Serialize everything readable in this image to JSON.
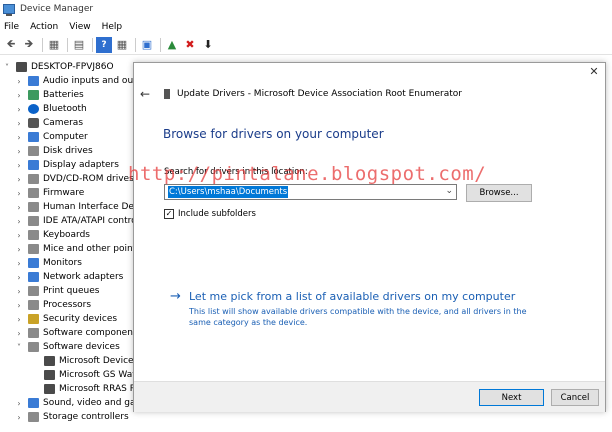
{
  "window": {
    "title": "Device Manager"
  },
  "menu": [
    "File",
    "Action",
    "View",
    "Help"
  ],
  "toolbar": [
    "back-arrow-icon",
    "forward-arrow-icon",
    "properties-icon",
    "scan-icon",
    "help-icon",
    "details-icon",
    "monitor-icon",
    "update-driver-icon",
    "uninstall-x-icon",
    "download-icon"
  ],
  "tree": {
    "root": "DESKTOP-FPVJ86O",
    "items": [
      {
        "label": "Audio inputs and out",
        "icon": "blue",
        "expanded": false
      },
      {
        "label": "Batteries",
        "icon": "green",
        "expanded": false
      },
      {
        "label": "Bluetooth",
        "icon": "bt",
        "expanded": false
      },
      {
        "label": "Cameras",
        "icon": "cam",
        "expanded": false
      },
      {
        "label": "Computer",
        "icon": "blue",
        "expanded": false
      },
      {
        "label": "Disk drives",
        "icon": "grey",
        "expanded": false
      },
      {
        "label": "Display adapters",
        "icon": "blue",
        "expanded": false
      },
      {
        "label": "DVD/CD-ROM drives",
        "icon": "grey",
        "expanded": false
      },
      {
        "label": "Firmware",
        "icon": "grey",
        "expanded": false
      },
      {
        "label": "Human Interface Dev",
        "icon": "grey",
        "expanded": false
      },
      {
        "label": "IDE ATA/ATAPI contro",
        "icon": "grey",
        "expanded": false
      },
      {
        "label": "Keyboards",
        "icon": "grey",
        "expanded": false
      },
      {
        "label": "Mice and other point",
        "icon": "grey",
        "expanded": false
      },
      {
        "label": "Monitors",
        "icon": "blue",
        "expanded": false
      },
      {
        "label": "Network adapters",
        "icon": "blue",
        "expanded": false
      },
      {
        "label": "Print queues",
        "icon": "grey",
        "expanded": false
      },
      {
        "label": "Processors",
        "icon": "grey",
        "expanded": false
      },
      {
        "label": "Security devices",
        "icon": "gold",
        "expanded": false
      },
      {
        "label": "Software component",
        "icon": "grey",
        "expanded": false
      },
      {
        "label": "Software devices",
        "icon": "grey",
        "expanded": true
      }
    ],
    "children": [
      "Microsoft Device",
      "Microsoft GS Wav",
      "Microsoft RRAS R"
    ],
    "after": [
      {
        "label": "Sound, video and gar",
        "icon": "blue"
      },
      {
        "label": "Storage controllers",
        "icon": "grey"
      }
    ]
  },
  "dialog": {
    "header": "Update Drivers - Microsoft Device Association Root Enumerator",
    "heading": "Browse for drivers on your computer",
    "search_label": "Search for drivers in this location:",
    "path_value": "C:\\Users\\mshaa\\Documents",
    "browse_label": "Browse...",
    "include_subfolders_label": "Include subfolders",
    "include_subfolders_checked": true,
    "link_title": "Let me pick from a list of available drivers on my computer",
    "link_desc": "This list will show available drivers compatible with the device, and all drivers in the same category as the device.",
    "next_label": "Next",
    "cancel_label": "Cancel"
  },
  "watermark": "http://pintalane.blogspot.com/",
  "colors": {
    "accent": "#0078d7",
    "link": "#1a5fb4",
    "heading": "#1a3c8a"
  }
}
